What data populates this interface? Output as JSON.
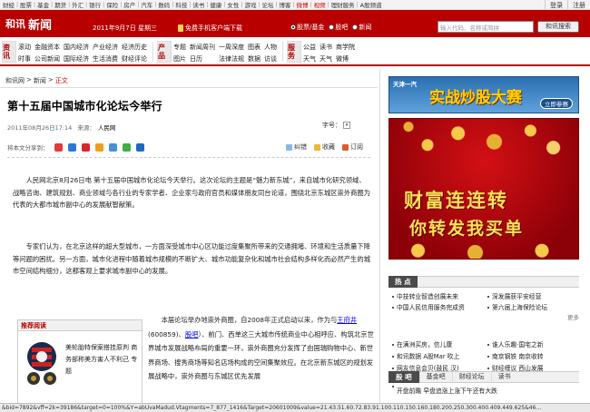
{
  "topnav": {
    "items": [
      "首页",
      "新闻",
      "股票",
      "基金",
      "期货",
      "期指",
      "债券",
      "外汇",
      "银行",
      "保险",
      "房产",
      "汽车",
      "科技",
      "数码",
      "健康",
      "体育",
      "娱乐",
      "读书",
      "美食"
    ],
    "right_items": [
      "新闻",
      "股票",
      "BBS",
      "微博",
      "视频",
      "理财服务",
      "A股频道",
      "注册"
    ],
    "accent": "#cc0000"
  },
  "topnav_visible": {
    "left": [
      "首页",
      "新闻",
      "股票",
      "基金",
      "期货",
      "期指",
      "债券",
      "外汇",
      "银行",
      "保险",
      "房产",
      "汽车",
      "科技",
      "数码",
      "健康",
      "体育",
      "娱乐",
      "读书",
      "美食"
    ],
    "links2": [
      "财经",
      "股票",
      "基金",
      "期货",
      "外汇",
      "银行",
      "保险",
      "房产",
      "汽车",
      "数码",
      "科技",
      "读书",
      "健康",
      "女性",
      "游戏",
      "论坛",
      "博客",
      "微博",
      "视频",
      "理财服务",
      "A股频道"
    ],
    "login": "登录",
    "logout": "注册"
  },
  "header": {
    "logo_mark": "和讯",
    "logo_channel": "新闻",
    "date": "2011年9月7日 星期三",
    "phone_text": "免费手机客户端下载",
    "radios": [
      "股票/基金",
      "股吧",
      "新闻"
    ],
    "search_placeholder": "输入代码、名称或简拼",
    "search_button": "和讯搜索",
    "bg": "#b80000"
  },
  "channels": [
    {
      "label": "资讯",
      "cols": [
        [
          "滚动",
          "时事"
        ],
        [
          "金融资本",
          "公司新闻"
        ],
        [
          "国内经济",
          "国际经济"
        ],
        [
          "产业经济",
          "生活消费"
        ],
        [
          "经济历史",
          "财经评论"
        ]
      ]
    },
    {
      "label": "产品",
      "cols": [
        [
          "专题",
          "图片"
        ],
        [
          "新闻周刊",
          "日历"
        ],
        [
          "一周深度",
          "法律法规"
        ],
        [
          "图表",
          "数据"
        ],
        [
          "人物",
          "访谈"
        ]
      ]
    },
    {
      "label": "服务",
      "cols": [
        [
          "公益",
          "天气"
        ],
        [
          "读书",
          "天气"
        ],
        [
          "商学院",
          "微博"
        ]
      ]
    }
  ],
  "breadcrumb": [
    "和讯网",
    ">",
    "新闻",
    ">",
    "正文"
  ],
  "article": {
    "title": "第十五届中国城市化论坛今举行",
    "datetime": "2011年08月26日17:14",
    "source_label": "来源：",
    "source": "人民网",
    "font_label": "字号：",
    "share_label": "将本文分享到：",
    "tools": [
      "纠错",
      "收藏",
      "订阅"
    ],
    "p1": "人民网北京8月26日电 第十五届中国城市化论坛今天举行。这次论坛的主题是“魅力新东城”，来自城市化研究领域、战略咨询、建筑规划、商业领域与各行业的专家学者、企业家与政府官员和媒体朋友同台论道，围绕北京东城区崇外商圈为代表的大都市城市副中心的发展献智献策。",
    "p2": "专家们认为，在北京这样的超大型城市，一方面深受城市中心区功能过度集聚所带来的交通拥堵、环境和生活质量下降等问题的困扰。另一方面，城市化进程中随着城市规模的不断扩大、城市功能复杂化和城市社会结构多样化而必然产生的城市空间结构细分，这都客观上要求城市副中心的发展。",
    "p3_a": "本届论坛举办地崇外商圈，自2008年正式启动以来，作为与",
    "p3_link1": "王府井",
    "p3_b": "(600859)、",
    "p3_link2": "股吧",
    "p3_c": "）、前门、西单这三大城市传统商业中心相呼应、构筑北京世界城市发展战略布局的重要一环，崇外商圈充分发挥了由国瑞购物中心、新世界商场、搜秀商场等知名店场构成的空间集聚效应。在北京新东城区的规划发展战略中，崇外商圈与东城区优先发展"
  },
  "recommend": {
    "head": "推荐阅读",
    "text": "美轮胎特保案搭挂原判 商务部称美方害人不利己 专题"
  },
  "ads": {
    "ad1_brand": "天津一汽",
    "ad1_big": "实战炒股大赛",
    "ad1_btn": "立即参赛",
    "ad2_line1": "财富连连转",
    "ad2_line2": "你转发我买单"
  },
  "hot": {
    "head": "热 点",
    "rows": [
      [
        "中技转业智造创展未来",
        "深发展获平安经营"
      ],
      [
        "中国人民信用服务完成资",
        "第六届上海保险论坛"
      ]
    ],
    "more": "更多"
  },
  "mid": {
    "rows": [
      [
        "在满洲买房，信儿康",
        "谁人乐趣·国宅之新"
      ],
      [
        "和讯数据 A股Mar 吹上",
        "南京钢铁 南京收转"
      ],
      [
        "网友信息会贝(鼓民 汉)",
        "财经缠议 西山发展"
      ]
    ]
  },
  "tabs": {
    "labels": [
      "股 吧",
      "基金吧",
      "财经论坛",
      "读书"
    ],
    "row": [
      "开盘前瞻  早盘追涨上涨下午还有大跌"
    ]
  },
  "statusbar": "&bid=7892&vff=2k=39186&target=0=100%&Y=abUvaMadud.Vtagments=7_877_1416&Target=20601009&value=21.43.51.60.72.83.91.100.110.150.160.180.200.250.300.400.409.449.625&46..."
}
